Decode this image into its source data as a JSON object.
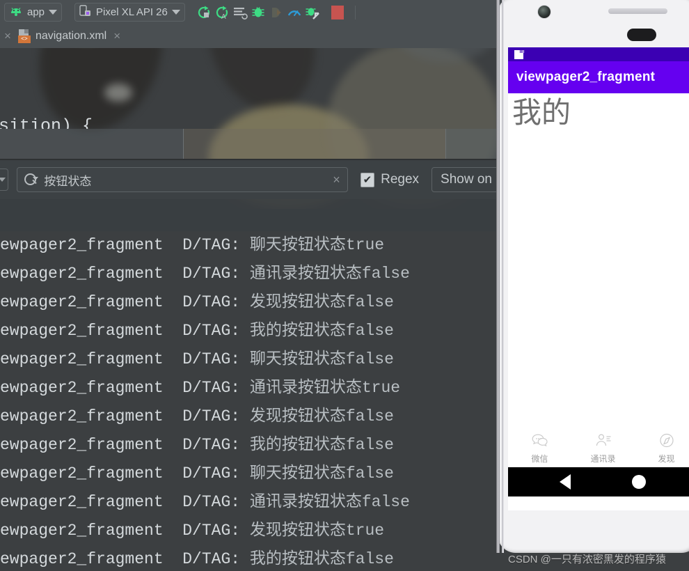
{
  "ide": {
    "toolbar": {
      "module_selector": {
        "label": "app",
        "icon": "android-head-icon"
      },
      "device_selector": {
        "label": "Pixel XL API 26",
        "icon": "device-icon"
      },
      "actions": [
        {
          "name": "run-button",
          "icon": "run-green-icon"
        },
        {
          "name": "run-with-coverage-button",
          "icon": "run-coverage-icon"
        },
        {
          "name": "apply-changes-button",
          "icon": "apply-changes-icon"
        },
        {
          "name": "debug-button",
          "icon": "debug-bug-icon"
        },
        {
          "name": "attach-debugger-button",
          "icon": "attach-debugger-icon"
        },
        {
          "name": "profiler-button",
          "icon": "profiler-gauge-icon"
        },
        {
          "name": "device-file-explorer-button",
          "icon": "deploy-icon"
        },
        {
          "name": "stop-button",
          "icon": "stop-square-icon"
        }
      ]
    },
    "tabs": {
      "close_all_label": "×",
      "items": [
        {
          "label": "navigation.xml",
          "icon": "xml-file-icon",
          "close_label": "×",
          "active": true
        }
      ]
    },
    "editor": {
      "code_line": "sition) {"
    },
    "logcat": {
      "filter_bar": {
        "level_selector_icon": "chevron-down-icon",
        "search": {
          "icon": "search-icon",
          "value": "按钮状态",
          "clear_label": "×"
        },
        "regex": {
          "label": "Regex",
          "checked": true,
          "check_glyph": "✔"
        },
        "show_only_button": {
          "label": "Show on"
        }
      },
      "lines": [
        {
          "prefix": "ewpager2_fragment  D/TAG: ",
          "message": "聊天按钮状态true"
        },
        {
          "prefix": "ewpager2_fragment  D/TAG: ",
          "message": "通讯录按钮状态false"
        },
        {
          "prefix": "ewpager2_fragment  D/TAG: ",
          "message": "发现按钮状态false"
        },
        {
          "prefix": "ewpager2_fragment  D/TAG: ",
          "message": "我的按钮状态false"
        },
        {
          "prefix": "ewpager2_fragment  D/TAG: ",
          "message": "聊天按钮状态false"
        },
        {
          "prefix": "ewpager2_fragment  D/TAG: ",
          "message": "通讯录按钮状态true"
        },
        {
          "prefix": "ewpager2_fragment  D/TAG: ",
          "message": "发现按钮状态false"
        },
        {
          "prefix": "ewpager2_fragment  D/TAG: ",
          "message": "我的按钮状态false"
        },
        {
          "prefix": "ewpager2_fragment  D/TAG: ",
          "message": "聊天按钮状态false"
        },
        {
          "prefix": "ewpager2_fragment  D/TAG: ",
          "message": "通讯录按钮状态false"
        },
        {
          "prefix": "ewpager2_fragment  D/TAG: ",
          "message": "发现按钮状态true"
        },
        {
          "prefix": "ewpager2_fragment  D/TAG: ",
          "message": "我的按钮状态false"
        }
      ]
    }
  },
  "emulator": {
    "device_frame": {
      "camera_icon": "camera-icon",
      "speaker_icon": "speaker-grill-icon",
      "sensor_icon": "proximity-sensor-icon"
    },
    "status_bar": {
      "sd_icon": "sd-card-icon"
    },
    "app_bar": {
      "title": "viewpager2_fragment"
    },
    "content": {
      "text": "我的"
    },
    "bottom_nav": [
      {
        "label": "微信",
        "icon": "chat-bubble-icon"
      },
      {
        "label": "通讯录",
        "icon": "contacts-icon"
      },
      {
        "label": "发现",
        "icon": "compass-icon"
      }
    ],
    "system_nav": {
      "back_icon": "back-triangle-icon",
      "home_icon": "home-circle-icon"
    }
  },
  "watermark": {
    "text": "CSDN @一只有浓密黑发的程序猿"
  },
  "colors": {
    "ide_chrome": "#4a4f52",
    "ide_panel": "#3c4144",
    "accent_purple": "#6500f0",
    "status_purple": "#3b00b3",
    "run_green": "#3ddc84",
    "stop_red": "#c75450",
    "xml_orange": "#d2763a"
  }
}
